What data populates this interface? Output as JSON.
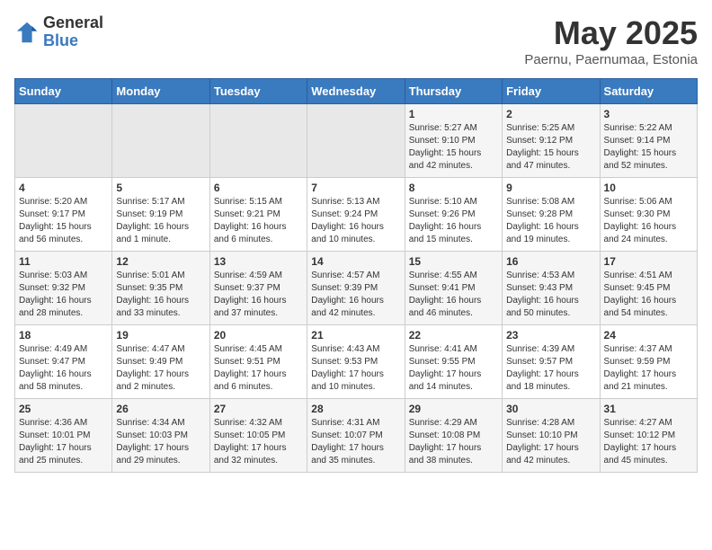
{
  "header": {
    "logo_general": "General",
    "logo_blue": "Blue",
    "title": "May 2025",
    "subtitle": "Paernu, Paernumaa, Estonia"
  },
  "days_of_week": [
    "Sunday",
    "Monday",
    "Tuesday",
    "Wednesday",
    "Thursday",
    "Friday",
    "Saturday"
  ],
  "weeks": [
    [
      {
        "day": "",
        "info": ""
      },
      {
        "day": "",
        "info": ""
      },
      {
        "day": "",
        "info": ""
      },
      {
        "day": "",
        "info": ""
      },
      {
        "day": "1",
        "info": "Sunrise: 5:27 AM\nSunset: 9:10 PM\nDaylight: 15 hours\nand 42 minutes."
      },
      {
        "day": "2",
        "info": "Sunrise: 5:25 AM\nSunset: 9:12 PM\nDaylight: 15 hours\nand 47 minutes."
      },
      {
        "day": "3",
        "info": "Sunrise: 5:22 AM\nSunset: 9:14 PM\nDaylight: 15 hours\nand 52 minutes."
      }
    ],
    [
      {
        "day": "4",
        "info": "Sunrise: 5:20 AM\nSunset: 9:17 PM\nDaylight: 15 hours\nand 56 minutes."
      },
      {
        "day": "5",
        "info": "Sunrise: 5:17 AM\nSunset: 9:19 PM\nDaylight: 16 hours\nand 1 minute."
      },
      {
        "day": "6",
        "info": "Sunrise: 5:15 AM\nSunset: 9:21 PM\nDaylight: 16 hours\nand 6 minutes."
      },
      {
        "day": "7",
        "info": "Sunrise: 5:13 AM\nSunset: 9:24 PM\nDaylight: 16 hours\nand 10 minutes."
      },
      {
        "day": "8",
        "info": "Sunrise: 5:10 AM\nSunset: 9:26 PM\nDaylight: 16 hours\nand 15 minutes."
      },
      {
        "day": "9",
        "info": "Sunrise: 5:08 AM\nSunset: 9:28 PM\nDaylight: 16 hours\nand 19 minutes."
      },
      {
        "day": "10",
        "info": "Sunrise: 5:06 AM\nSunset: 9:30 PM\nDaylight: 16 hours\nand 24 minutes."
      }
    ],
    [
      {
        "day": "11",
        "info": "Sunrise: 5:03 AM\nSunset: 9:32 PM\nDaylight: 16 hours\nand 28 minutes."
      },
      {
        "day": "12",
        "info": "Sunrise: 5:01 AM\nSunset: 9:35 PM\nDaylight: 16 hours\nand 33 minutes."
      },
      {
        "day": "13",
        "info": "Sunrise: 4:59 AM\nSunset: 9:37 PM\nDaylight: 16 hours\nand 37 minutes."
      },
      {
        "day": "14",
        "info": "Sunrise: 4:57 AM\nSunset: 9:39 PM\nDaylight: 16 hours\nand 42 minutes."
      },
      {
        "day": "15",
        "info": "Sunrise: 4:55 AM\nSunset: 9:41 PM\nDaylight: 16 hours\nand 46 minutes."
      },
      {
        "day": "16",
        "info": "Sunrise: 4:53 AM\nSunset: 9:43 PM\nDaylight: 16 hours\nand 50 minutes."
      },
      {
        "day": "17",
        "info": "Sunrise: 4:51 AM\nSunset: 9:45 PM\nDaylight: 16 hours\nand 54 minutes."
      }
    ],
    [
      {
        "day": "18",
        "info": "Sunrise: 4:49 AM\nSunset: 9:47 PM\nDaylight: 16 hours\nand 58 minutes."
      },
      {
        "day": "19",
        "info": "Sunrise: 4:47 AM\nSunset: 9:49 PM\nDaylight: 17 hours\nand 2 minutes."
      },
      {
        "day": "20",
        "info": "Sunrise: 4:45 AM\nSunset: 9:51 PM\nDaylight: 17 hours\nand 6 minutes."
      },
      {
        "day": "21",
        "info": "Sunrise: 4:43 AM\nSunset: 9:53 PM\nDaylight: 17 hours\nand 10 minutes."
      },
      {
        "day": "22",
        "info": "Sunrise: 4:41 AM\nSunset: 9:55 PM\nDaylight: 17 hours\nand 14 minutes."
      },
      {
        "day": "23",
        "info": "Sunrise: 4:39 AM\nSunset: 9:57 PM\nDaylight: 17 hours\nand 18 minutes."
      },
      {
        "day": "24",
        "info": "Sunrise: 4:37 AM\nSunset: 9:59 PM\nDaylight: 17 hours\nand 21 minutes."
      }
    ],
    [
      {
        "day": "25",
        "info": "Sunrise: 4:36 AM\nSunset: 10:01 PM\nDaylight: 17 hours\nand 25 minutes."
      },
      {
        "day": "26",
        "info": "Sunrise: 4:34 AM\nSunset: 10:03 PM\nDaylight: 17 hours\nand 29 minutes."
      },
      {
        "day": "27",
        "info": "Sunrise: 4:32 AM\nSunset: 10:05 PM\nDaylight: 17 hours\nand 32 minutes."
      },
      {
        "day": "28",
        "info": "Sunrise: 4:31 AM\nSunset: 10:07 PM\nDaylight: 17 hours\nand 35 minutes."
      },
      {
        "day": "29",
        "info": "Sunrise: 4:29 AM\nSunset: 10:08 PM\nDaylight: 17 hours\nand 38 minutes."
      },
      {
        "day": "30",
        "info": "Sunrise: 4:28 AM\nSunset: 10:10 PM\nDaylight: 17 hours\nand 42 minutes."
      },
      {
        "day": "31",
        "info": "Sunrise: 4:27 AM\nSunset: 10:12 PM\nDaylight: 17 hours\nand 45 minutes."
      }
    ]
  ]
}
